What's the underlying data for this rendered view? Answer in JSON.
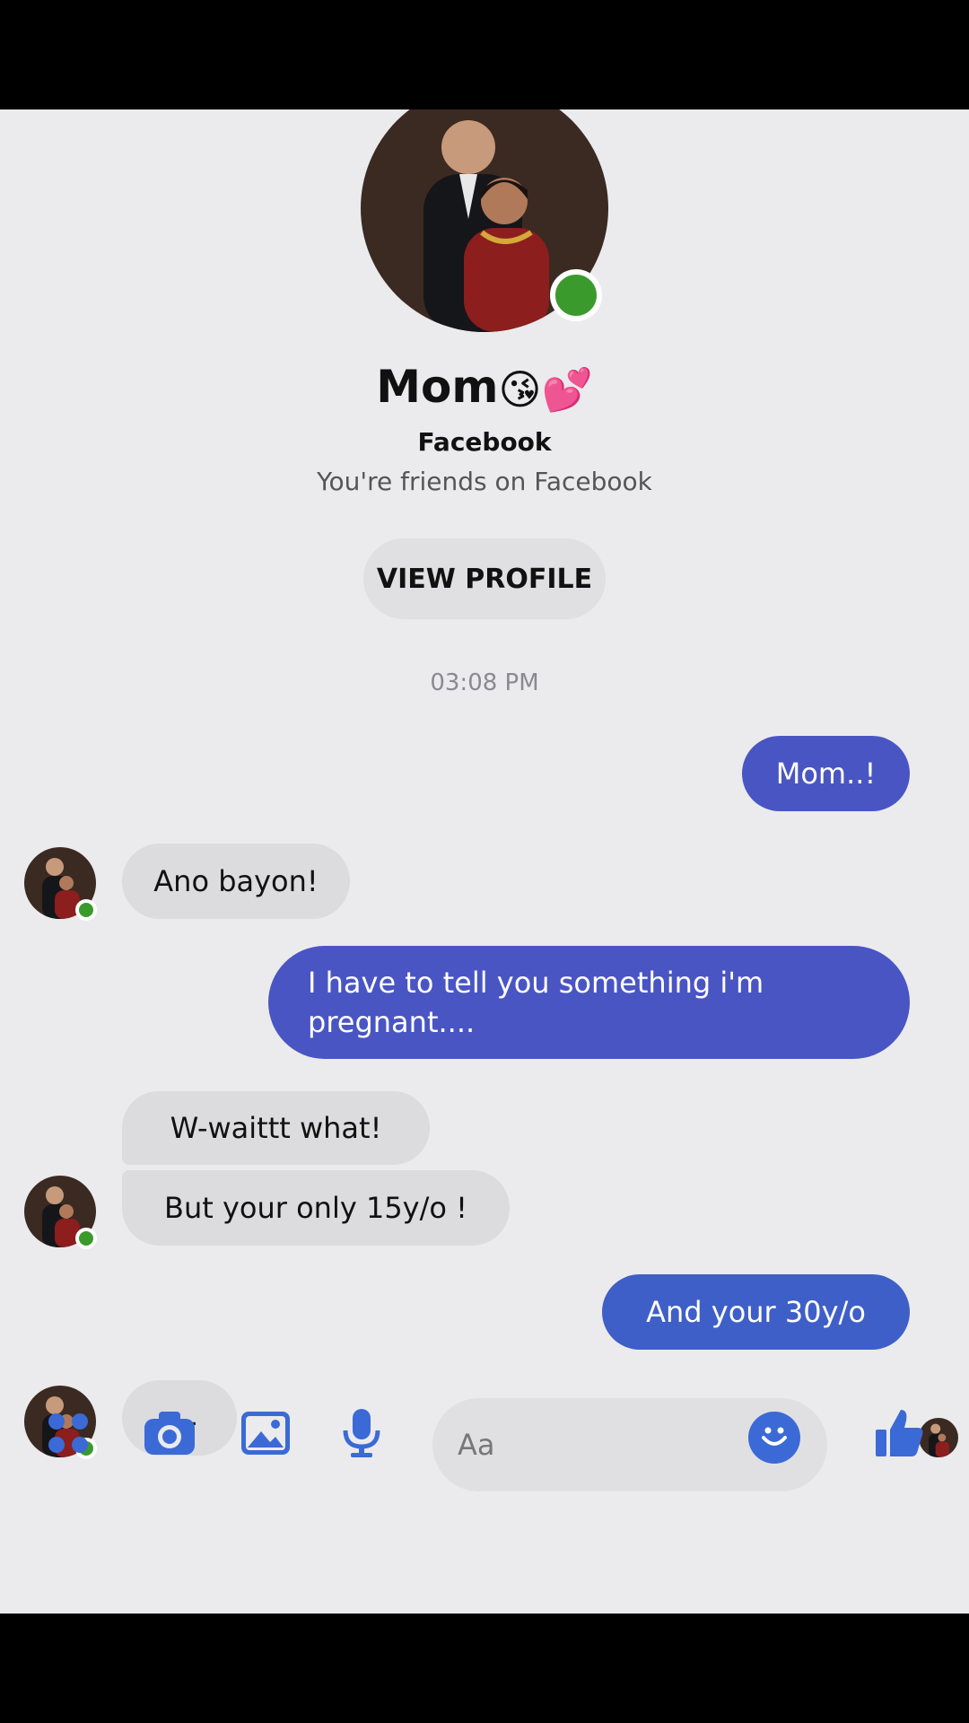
{
  "contact": {
    "name": "Mom",
    "name_emojis": "😘💕",
    "platform": "Facebook",
    "friends_text": "You're friends on Facebook",
    "view_profile_label": "VIEW PROFILE",
    "online": true
  },
  "conversation": {
    "timestamp": "03:08 PM",
    "messages": [
      {
        "from": "me",
        "text": "Mom..!"
      },
      {
        "from": "contact",
        "text": "Ano bayon!"
      },
      {
        "from": "me",
        "text": "I have to tell you something i'm pregnant...."
      },
      {
        "from": "contact",
        "text": "W-waittt what!"
      },
      {
        "from": "contact",
        "text": "But your only 15y/o !"
      },
      {
        "from": "me",
        "text": "And your 30y/o"
      },
      {
        "from": "contact",
        "text": "....."
      }
    ]
  },
  "composer": {
    "placeholder": "Aa"
  },
  "icons": [
    "apps-icon",
    "camera-icon",
    "gallery-icon",
    "microphone-icon",
    "emoji-icon",
    "thumbs-up-icon"
  ],
  "colors": {
    "outgoing_bubble": "#4a55c4",
    "incoming_bubble": "#dcdcde",
    "accent": "#3b6ad6",
    "online": "#3a9a2c"
  }
}
